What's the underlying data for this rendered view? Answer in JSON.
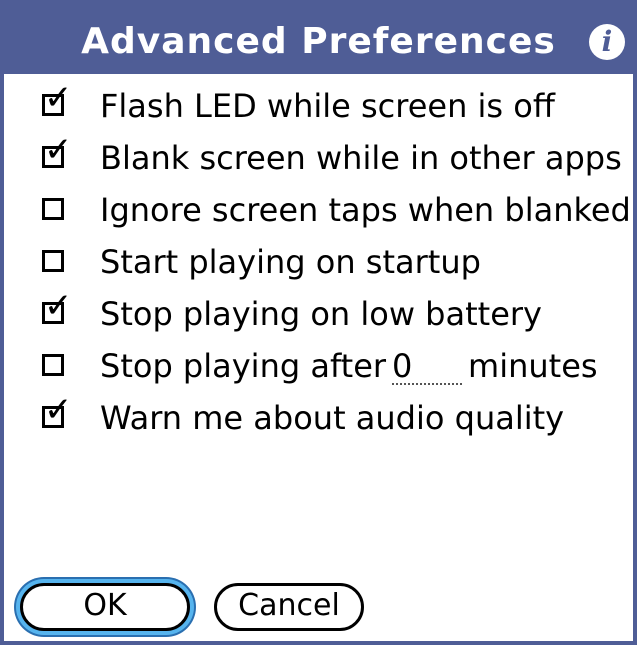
{
  "dialog": {
    "title": "Advanced Preferences",
    "info_icon": "info-icon"
  },
  "options": [
    {
      "label": "Flash LED while screen is off",
      "checked": true
    },
    {
      "label": "Blank screen while in other apps",
      "checked": true
    },
    {
      "label": "Ignore screen taps when blanked",
      "checked": false
    },
    {
      "label": "Start playing on startup",
      "checked": false
    },
    {
      "label": "Stop playing on low battery",
      "checked": true
    },
    {
      "label_before": "Stop playing after",
      "value": "0",
      "label_after": "minutes",
      "checked": false
    },
    {
      "label": "Warn me about audio quality",
      "checked": true
    }
  ],
  "buttons": {
    "ok": "OK",
    "cancel": "Cancel"
  },
  "colors": {
    "frame": "#4f5d96",
    "focus_ring": "#56b4ee"
  }
}
